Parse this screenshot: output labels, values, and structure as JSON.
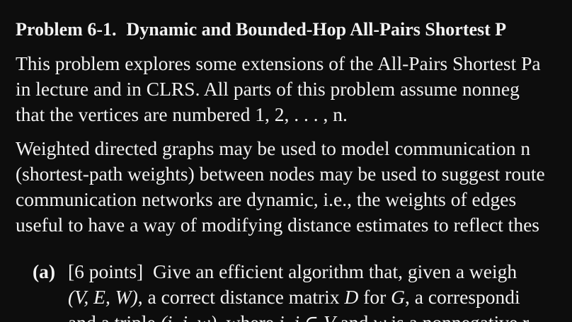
{
  "problem": {
    "number": "Problem 6-1.",
    "title": "Dynamic and Bounded-Hop All-Pairs Shortest P"
  },
  "intro": {
    "line1": "This problem explores some extensions of the All-Pairs Shortest Pa",
    "line2": "in lecture and in CLRS. All parts of this problem assume nonneg",
    "line3_text": "that the vertices are numbered ",
    "line3_math": "1, 2, . . . , n."
  },
  "motivation": {
    "line1": "Weighted directed graphs may be used to model communication n",
    "line2": "(shortest-path weights) between nodes may be used to suggest route",
    "line3": "communication networks are dynamic, i.e., the weights of edges",
    "line4": "useful to have a way of modifying distance estimates to reflect thes"
  },
  "part_a": {
    "label": "(a)",
    "points": "[6 points]",
    "line1_text": "Give an efficient algorithm that, given a weigh",
    "line2_math1": "(V, E, W)",
    "line2_text1": ", a correct distance matrix ",
    "line2_math2": "D",
    "line2_text2": " for ",
    "line2_math3": "G",
    "line2_text3": ", a correspondi",
    "line3_text1": "and a triple ",
    "line3_math1": "(i, j, w)",
    "line3_text2": ", where ",
    "line3_math2": "i, j ∈ V",
    "line3_text3": " and ",
    "line3_math3": "w",
    "line3_text4": " is a nonnegative r"
  }
}
